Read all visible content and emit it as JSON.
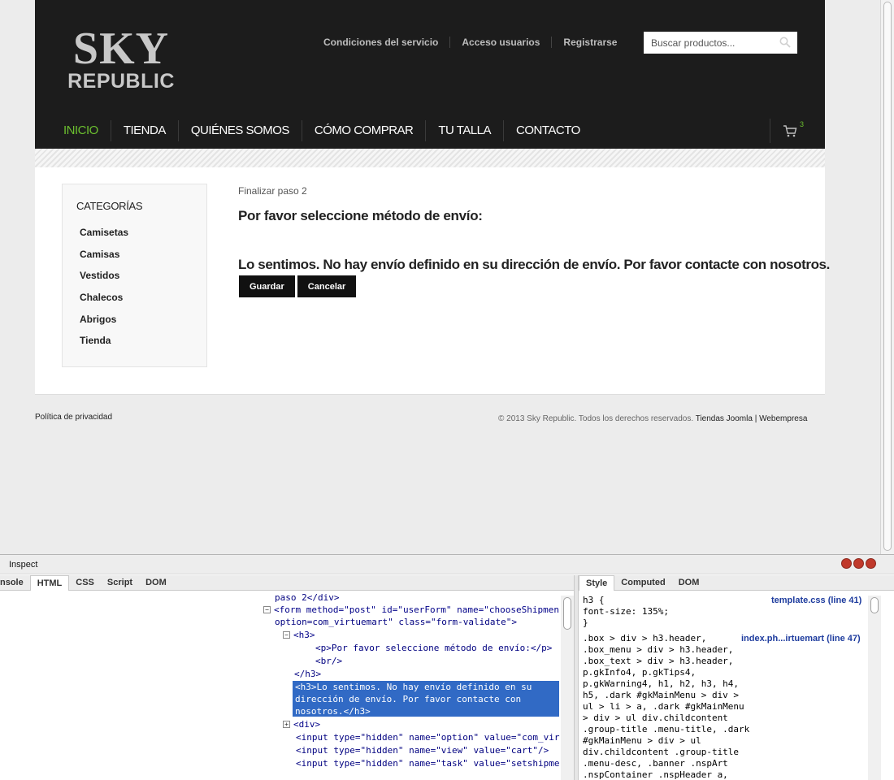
{
  "logo": {
    "line1": "SKY",
    "line2": "REPUBLIC"
  },
  "toplinks": [
    "Condiciones del servicio",
    "Acceso usuarios",
    "Registrarse"
  ],
  "search": {
    "placeholder": "Buscar productos..."
  },
  "menu": {
    "items": [
      "INICIO",
      "TIENDA",
      "QUIÉNES SOMOS",
      "CÓMO COMPRAR",
      "TU TALLA",
      "CONTACTO"
    ],
    "active": "INICIO"
  },
  "cart": {
    "count": "3"
  },
  "sidebar": {
    "title": "CATEGORÍAS",
    "items": [
      "Camisetas",
      "Camisas",
      "Vestidos",
      "Chalecos",
      "Abrigos",
      "Tienda"
    ]
  },
  "main": {
    "step": "Finalizar paso 2",
    "heading": "Por favor seleccione método de envío:",
    "message": "Lo sentimos. No hay envío definido en su dirección de envío. Por favor contacte con nosotros.",
    "save_label": "Guardar",
    "cancel_label": "Cancelar"
  },
  "footer": {
    "privacy": "Política de privacidad",
    "copyright": "© 2013 Sky Republic. Todos los derechos reservados.",
    "link1": "Tiendas Joomla",
    "separator": "|",
    "link2": "Webempresa"
  },
  "firebug": {
    "title": "Inspect",
    "left_tabs": [
      "nsole",
      "HTML",
      "CSS",
      "Script",
      "DOM"
    ],
    "left_active": "HTML",
    "right_tabs": [
      "Style",
      "Computed",
      "DOM"
    ],
    "right_active": "Style",
    "html_lines": [
      "paso 2</div>",
      "<form method=\"post\" id=\"userForm\" name=\"chooseShipmen",
      "option=com_virtuemart\" class=\"form-validate\">",
      "<h3>",
      "<p>Por favor seleccione método de envío:</p>",
      "<br/>",
      "</h3>",
      "<h3>Lo sentimos. No hay envío definido en su",
      "dirección de envío. Por favor contacte con",
      "nosotros.</h3>",
      "<div>",
      "<input type=\"hidden\" name=\"option\" value=\"com_vir",
      "<input type=\"hidden\" name=\"view\" value=\"cart\"/>",
      "<input type=\"hidden\" name=\"task\" value=\"setshipme"
    ],
    "css_source1": "template.css (line 41)",
    "css_source2": "index.ph...irtuemart (line 47)",
    "css_lines": [
      "h3 {",
      "  font-size: 135%;",
      "}",
      ".box > div > h3.header,",
      ".box_menu > div > h3.header,",
      ".box_text > div > h3.header,",
      "p.gkInfo4, p.gkTips4,",
      "p.gkWarning4, h1, h2, h3, h4,",
      "h5, .dark #gkMainMenu > div >",
      "ul > li > a, .dark #gkMainMenu",
      "> div > ul div.childcontent",
      ".group-title .menu-title, .dark",
      "#gkMainMenu > div > ul",
      "div.childcontent .group-title",
      ".menu-desc, .banner .nspArt",
      ".nspContainer .nspHeader a,"
    ]
  }
}
